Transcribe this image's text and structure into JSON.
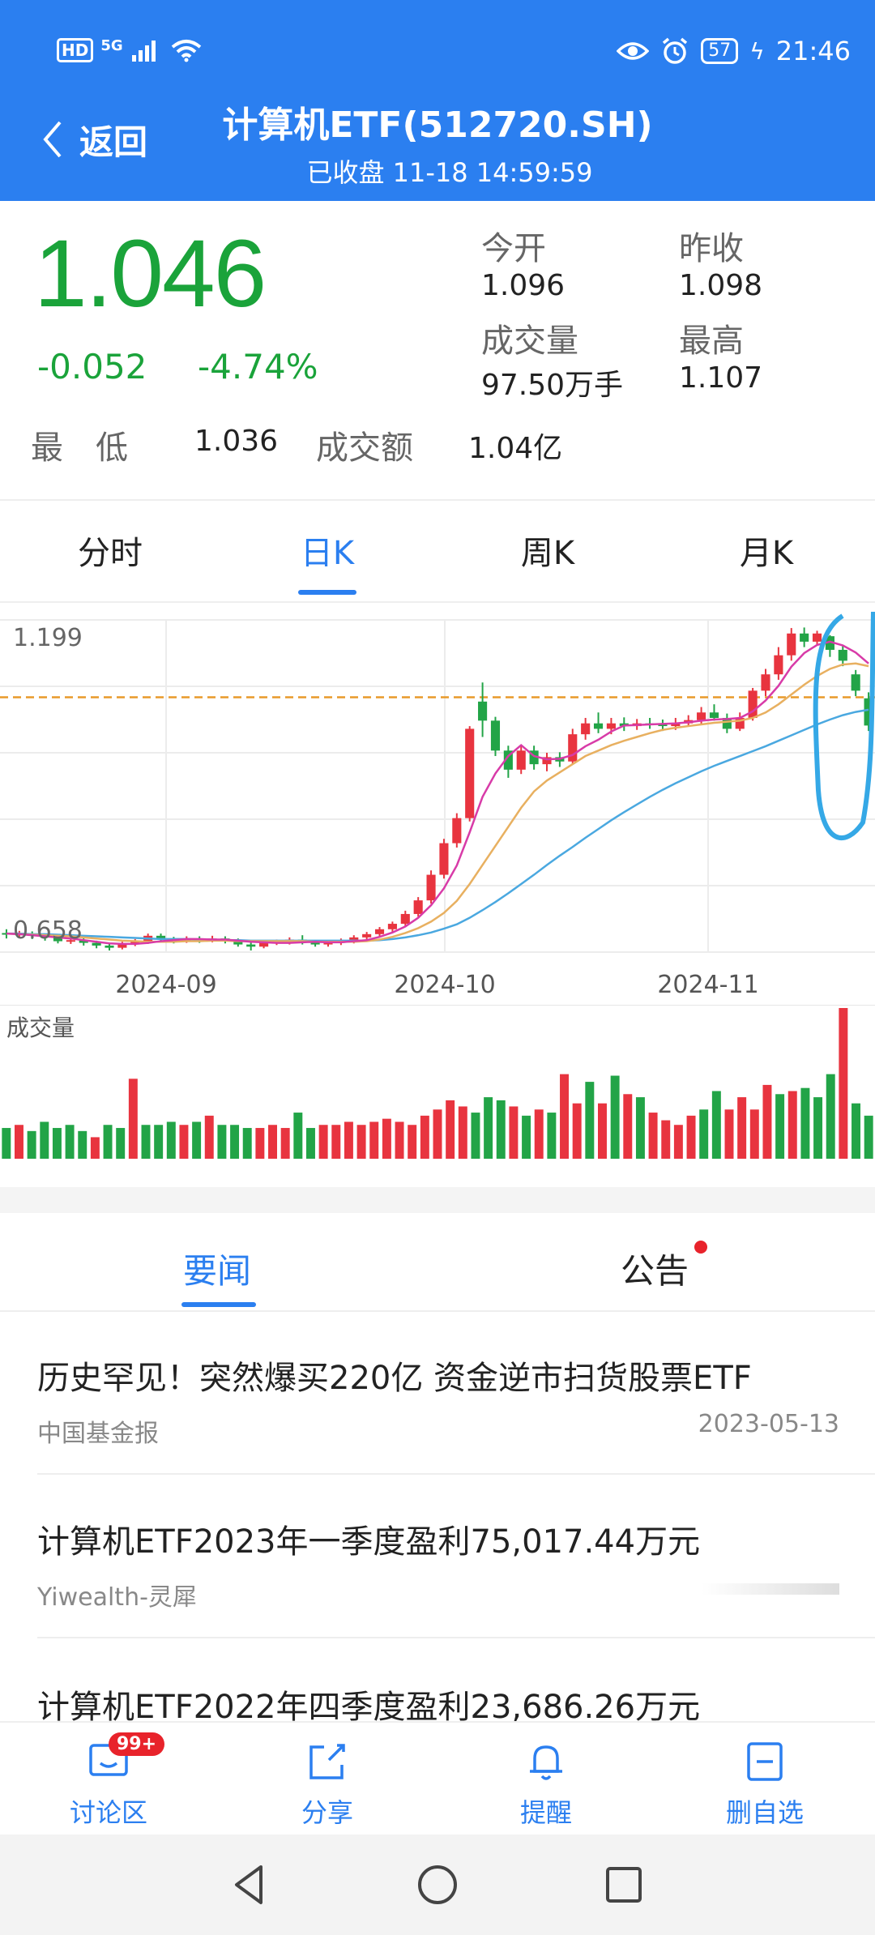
{
  "status_bar": {
    "left": "5G",
    "hd": "HD",
    "battery": "57",
    "time": "21:46"
  },
  "header": {
    "back_label": "返回",
    "title": "计算机ETF(512720.SH)",
    "subtitle": "已收盘 11-18 14:59:59"
  },
  "quote": {
    "price": "1.046",
    "change": "-0.052",
    "change_pct": "-4.74%",
    "open_label": "今开",
    "open": "1.096",
    "prev_close_label": "昨收",
    "prev_close": "1.098",
    "volume_label": "成交量",
    "volume": "97.50万手",
    "high_label": "最高",
    "high": "1.107",
    "low_label": "最　低",
    "low": "1.036",
    "turnover_label": "成交额",
    "turnover": "1.04亿"
  },
  "chart_tabs": [
    "分时",
    "日K",
    "周K",
    "月K"
  ],
  "chart_data": {
    "type": "candlestick",
    "y_top_label": "1.199",
    "y_bottom_label": "0.658",
    "x_labels": [
      "2024-09",
      "2024-10",
      "2024-11"
    ],
    "prev_close_line": 1.098,
    "colors": {
      "up": "#e8343f",
      "down": "#22a447",
      "ma5": "#d83ba8",
      "ma10": "#e8b060",
      "ma20": "#4aa8e0",
      "circle": "#35a8e6"
    },
    "candles": [
      [
        0.665,
        0.662,
        0.672,
        0.655
      ],
      [
        0.662,
        0.664,
        0.669,
        0.657
      ],
      [
        0.664,
        0.66,
        0.668,
        0.654
      ],
      [
        0.66,
        0.657,
        0.664,
        0.651
      ],
      [
        0.657,
        0.65,
        0.661,
        0.646
      ],
      [
        0.65,
        0.652,
        0.656,
        0.645
      ],
      [
        0.652,
        0.647,
        0.656,
        0.642
      ],
      [
        0.647,
        0.642,
        0.651,
        0.637
      ],
      [
        0.642,
        0.638,
        0.647,
        0.633
      ],
      [
        0.638,
        0.645,
        0.649,
        0.635
      ],
      [
        0.645,
        0.649,
        0.654,
        0.641
      ],
      [
        0.649,
        0.66,
        0.664,
        0.645
      ],
      [
        0.66,
        0.654,
        0.664,
        0.649
      ],
      [
        0.654,
        0.651,
        0.658,
        0.646
      ],
      [
        0.651,
        0.655,
        0.659,
        0.647
      ],
      [
        0.655,
        0.652,
        0.659,
        0.647
      ],
      [
        0.652,
        0.655,
        0.66,
        0.648
      ],
      [
        0.655,
        0.651,
        0.659,
        0.646
      ],
      [
        0.651,
        0.644,
        0.655,
        0.64
      ],
      [
        0.644,
        0.64,
        0.648,
        0.633
      ],
      [
        0.64,
        0.648,
        0.652,
        0.637
      ],
      [
        0.648,
        0.649,
        0.653,
        0.643
      ],
      [
        0.649,
        0.653,
        0.657,
        0.644
      ],
      [
        0.653,
        0.648,
        0.661,
        0.644
      ],
      [
        0.648,
        0.644,
        0.651,
        0.64
      ],
      [
        0.644,
        0.647,
        0.651,
        0.64
      ],
      [
        0.647,
        0.65,
        0.655,
        0.643
      ],
      [
        0.65,
        0.657,
        0.661,
        0.646
      ],
      [
        0.657,
        0.663,
        0.667,
        0.652
      ],
      [
        0.663,
        0.672,
        0.676,
        0.658
      ],
      [
        0.672,
        0.682,
        0.686,
        0.667
      ],
      [
        0.682,
        0.7,
        0.706,
        0.676
      ],
      [
        0.7,
        0.725,
        0.731,
        0.695
      ],
      [
        0.725,
        0.772,
        0.78,
        0.719
      ],
      [
        0.772,
        0.83,
        0.838,
        0.765
      ],
      [
        0.83,
        0.876,
        0.885,
        0.822
      ],
      [
        0.876,
        1.04,
        1.045,
        0.87
      ],
      [
        1.09,
        1.055,
        1.125,
        1.025
      ],
      [
        1.055,
        1.0,
        1.062,
        0.99
      ],
      [
        1.0,
        0.965,
        1.009,
        0.95
      ],
      [
        0.965,
        1.0,
        1.01,
        0.957
      ],
      [
        1.0,
        0.975,
        1.009,
        0.965
      ],
      [
        0.975,
        0.988,
        0.996,
        0.962
      ],
      [
        0.988,
        0.98,
        0.997,
        0.97
      ],
      [
        0.98,
        1.03,
        1.04,
        0.975
      ],
      [
        1.03,
        1.05,
        1.06,
        1.02
      ],
      [
        1.05,
        1.04,
        1.07,
        1.032
      ],
      [
        1.04,
        1.05,
        1.06,
        1.03
      ],
      [
        1.05,
        1.045,
        1.061,
        1.036
      ],
      [
        1.045,
        1.05,
        1.058,
        1.038
      ],
      [
        1.05,
        1.048,
        1.06,
        1.04
      ],
      [
        1.048,
        1.045,
        1.057,
        1.036
      ],
      [
        1.045,
        1.05,
        1.06,
        1.038
      ],
      [
        1.05,
        1.056,
        1.065,
        1.045
      ],
      [
        1.056,
        1.07,
        1.08,
        1.048
      ],
      [
        1.07,
        1.06,
        1.085,
        1.055
      ],
      [
        1.06,
        1.04,
        1.068,
        1.032
      ],
      [
        1.04,
        1.06,
        1.07,
        1.036
      ],
      [
        1.06,
        1.11,
        1.115,
        1.055
      ],
      [
        1.11,
        1.14,
        1.15,
        1.1
      ],
      [
        1.14,
        1.175,
        1.19,
        1.13
      ],
      [
        1.175,
        1.215,
        1.225,
        1.165
      ],
      [
        1.215,
        1.2,
        1.226,
        1.19
      ],
      [
        1.2,
        1.215,
        1.22,
        1.195
      ],
      [
        1.21,
        1.185,
        1.212,
        1.172
      ],
      [
        1.185,
        1.165,
        1.192,
        1.155
      ],
      [
        1.14,
        1.11,
        1.148,
        1.1
      ],
      [
        1.096,
        1.046,
        1.107,
        1.036
      ]
    ],
    "ma5": [
      0.664,
      0.663,
      0.661,
      0.659,
      0.657,
      0.655,
      0.652,
      0.649,
      0.646,
      0.645,
      0.645,
      0.647,
      0.65,
      0.652,
      0.654,
      0.654,
      0.653,
      0.653,
      0.651,
      0.649,
      0.648,
      0.647,
      0.647,
      0.648,
      0.649,
      0.648,
      0.648,
      0.65,
      0.652,
      0.658,
      0.666,
      0.677,
      0.693,
      0.716,
      0.747,
      0.789,
      0.85,
      0.915,
      0.958,
      0.99,
      1.01,
      0.99,
      0.984,
      0.985,
      0.992,
      1.008,
      1.02,
      1.035,
      1.046,
      1.047,
      1.048,
      1.049,
      1.05,
      1.052,
      1.055,
      1.057,
      1.058,
      1.06,
      1.072,
      1.092,
      1.119,
      1.154,
      1.179,
      1.194,
      1.2,
      1.193,
      1.18,
      1.16
    ],
    "ma10": [
      0.664,
      0.663,
      0.662,
      0.661,
      0.66,
      0.659,
      0.657,
      0.655,
      0.653,
      0.651,
      0.65,
      0.649,
      0.649,
      0.649,
      0.65,
      0.65,
      0.651,
      0.651,
      0.65,
      0.65,
      0.65,
      0.65,
      0.65,
      0.65,
      0.649,
      0.649,
      0.649,
      0.649,
      0.65,
      0.653,
      0.658,
      0.665,
      0.674,
      0.686,
      0.702,
      0.724,
      0.755,
      0.79,
      0.825,
      0.86,
      0.895,
      0.925,
      0.945,
      0.96,
      0.975,
      0.99,
      1.0,
      1.01,
      1.018,
      1.025,
      1.032,
      1.038,
      1.042,
      1.045,
      1.048,
      1.051,
      1.053,
      1.055,
      1.06,
      1.07,
      1.085,
      1.103,
      1.121,
      1.137,
      1.15,
      1.158,
      1.16,
      1.155
    ],
    "ma20": [
      0.664,
      0.664,
      0.663,
      0.663,
      0.662,
      0.661,
      0.66,
      0.659,
      0.658,
      0.657,
      0.656,
      0.655,
      0.654,
      0.654,
      0.654,
      0.653,
      0.653,
      0.652,
      0.652,
      0.651,
      0.651,
      0.651,
      0.651,
      0.651,
      0.651,
      0.651,
      0.651,
      0.651,
      0.651,
      0.652,
      0.654,
      0.657,
      0.661,
      0.666,
      0.673,
      0.681,
      0.693,
      0.707,
      0.722,
      0.738,
      0.755,
      0.772,
      0.79,
      0.807,
      0.823,
      0.84,
      0.856,
      0.872,
      0.887,
      0.901,
      0.915,
      0.928,
      0.94,
      0.951,
      0.962,
      0.972,
      0.981,
      0.99,
      0.999,
      1.008,
      1.018,
      1.028,
      1.038,
      1.048,
      1.057,
      1.065,
      1.071,
      1.075
    ],
    "volume_label": "成交量",
    "volume": [
      20,
      22,
      18,
      24,
      20,
      22,
      18,
      14,
      22,
      20,
      52,
      22,
      22,
      24,
      22,
      24,
      28,
      22,
      22,
      20,
      20,
      22,
      20,
      30,
      20,
      22,
      22,
      24,
      22,
      24,
      26,
      24,
      22,
      28,
      32,
      38,
      34,
      30,
      40,
      38,
      34,
      28,
      32,
      30,
      55,
      36,
      50,
      36,
      54,
      42,
      40,
      30,
      25,
      22,
      28,
      32,
      44,
      32,
      40,
      32,
      48,
      42,
      44,
      46,
      40,
      55,
      98,
      36,
      28
    ],
    "volume_up": [
      false,
      true,
      false,
      false,
      false,
      false,
      false,
      true,
      false,
      false,
      true,
      false,
      false,
      false,
      true,
      false,
      true,
      false,
      false,
      false,
      true,
      true,
      true,
      false,
      false,
      true,
      true,
      true,
      true,
      true,
      true,
      true,
      true,
      true,
      true,
      true,
      true,
      false,
      false,
      false,
      true,
      false,
      true,
      false,
      true,
      true,
      false,
      true,
      false,
      true,
      false,
      true,
      true,
      true,
      true,
      false,
      false,
      true,
      true,
      true,
      true,
      false,
      true,
      false,
      false,
      false,
      true,
      false,
      false
    ]
  },
  "news_tabs": {
    "news": "要闻",
    "notice": "公告"
  },
  "news": [
    {
      "title": "历史罕见！突然爆买220亿 资金逆市扫货股票ETF",
      "source": "中国基金报",
      "date": "2023-05-13"
    },
    {
      "title": "计算机ETF2023年一季度盈利75,017.44万元",
      "source": "Yiwealth-灵犀",
      "date": ""
    },
    {
      "title": "计算机ETF2022年四季度盈利23,686.26万元",
      "source": "",
      "date": ""
    }
  ],
  "toolbar": {
    "badge": "99+",
    "discuss": "讨论区",
    "share": "分享",
    "remind": "提醒",
    "remove": "删自选"
  }
}
